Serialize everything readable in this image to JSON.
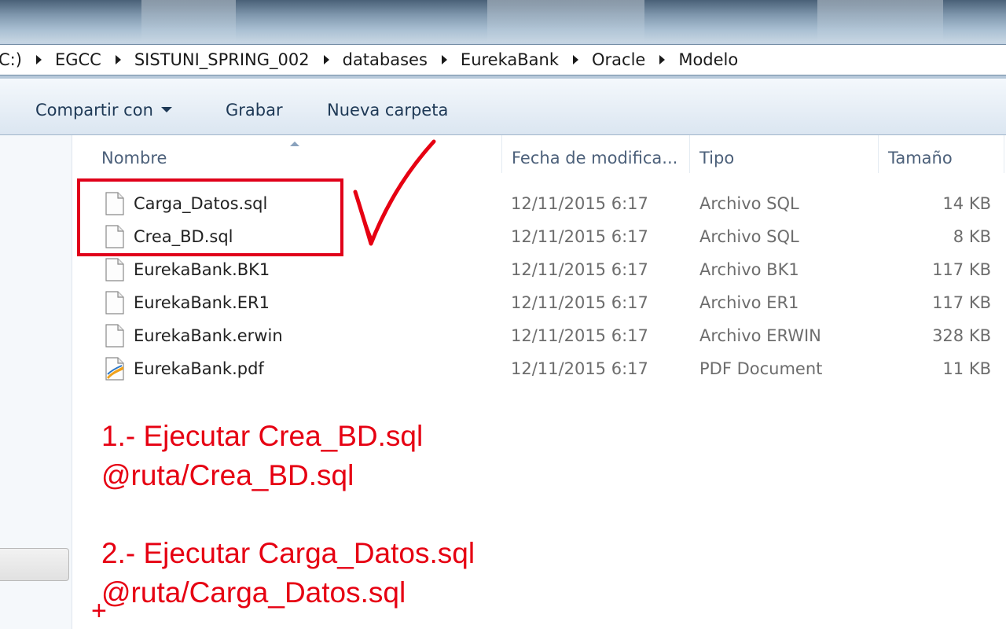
{
  "address_bar": {
    "crumbs": [
      "C:)",
      "EGCC",
      "SISTUNI_SPRING_002",
      "databases",
      "EurekaBank",
      "Oracle",
      "Modelo"
    ]
  },
  "toolbar": {
    "share_label": "Compartir con",
    "burn_label": "Grabar",
    "new_folder_label": "Nueva carpeta"
  },
  "columns": {
    "name": "Nombre",
    "date": "Fecha de modifica...",
    "type": "Tipo",
    "size": "Tamaño"
  },
  "files": [
    {
      "name": "Carga_Datos.sql",
      "date": "12/11/2015 6:17",
      "type": "Archivo SQL",
      "size": "14 KB",
      "icon": "document-icon"
    },
    {
      "name": "Crea_BD.sql",
      "date": "12/11/2015 6:17",
      "type": "Archivo SQL",
      "size": "8 KB",
      "icon": "document-icon"
    },
    {
      "name": "EurekaBank.BK1",
      "date": "12/11/2015 6:17",
      "type": "Archivo BK1",
      "size": "117 KB",
      "icon": "document-icon"
    },
    {
      "name": "EurekaBank.ER1",
      "date": "12/11/2015 6:17",
      "type": "Archivo ER1",
      "size": "117 KB",
      "icon": "document-icon"
    },
    {
      "name": "EurekaBank.erwin",
      "date": "12/11/2015 6:17",
      "type": "Archivo ERWIN",
      "size": "328 KB",
      "icon": "document-icon"
    },
    {
      "name": "EurekaBank.pdf",
      "date": "12/11/2015 6:17",
      "type": "PDF Document",
      "size": "11 KB",
      "icon": "pdf-icon"
    }
  ],
  "annotations": {
    "step1": "1.- Ejecutar Crea_BD.sql",
    "step1_cmd": "@ruta/Crea_BD.sql",
    "step2": "2.- Ejecutar Carga_Datos.sql",
    "step2_cmd": "@ruta/Carga_Datos.sql",
    "plus": "+",
    "color": "#e60012"
  }
}
